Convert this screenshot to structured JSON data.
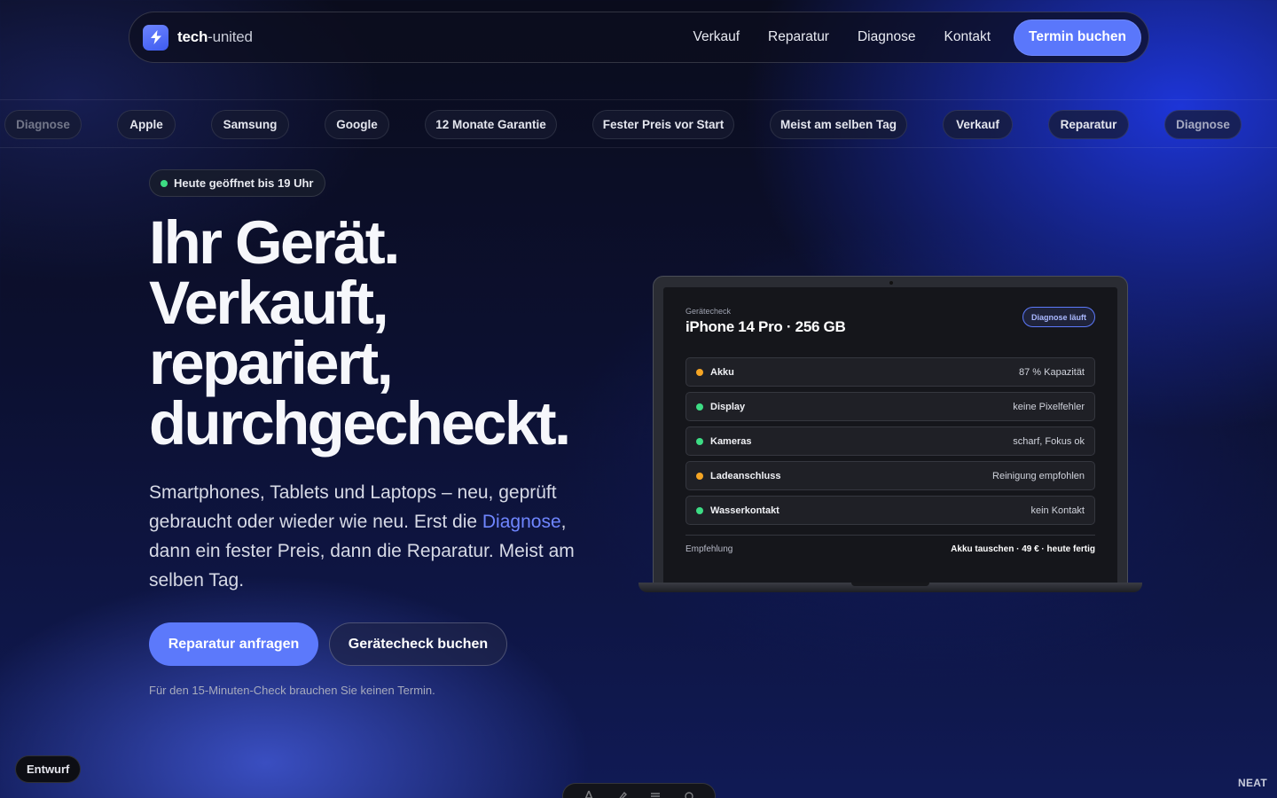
{
  "nav": {
    "brand_bold": "tech",
    "brand_rest": "-united",
    "links": [
      "Verkauf",
      "Reparatur",
      "Diagnose",
      "Kontakt"
    ],
    "cta": "Termin buchen",
    "logo_icon": "lightning-bolt-icon"
  },
  "ticker": {
    "chips": [
      "Diagnose",
      "Apple",
      "Samsung",
      "Google",
      "12 Monate Garantie",
      "Fester Preis vor Start",
      "Meist am selben Tag",
      "Verkauf",
      "Reparatur",
      "Diagnose"
    ]
  },
  "hero": {
    "status": "Heute geöffnet bis 19 Uhr",
    "headline": [
      "Ihr Gerät.",
      "Verkauft,",
      "repariert,",
      "durchgecheckt."
    ],
    "sub_before": "Smartphones, Tablets und Laptops – neu, geprüft gebraucht oder wieder wie neu. Erst die ",
    "sub_accent": "Diagnose",
    "sub_after": ", dann ein fester Preis, dann die Reparatur. Meist am selben Tag.",
    "primary_cta": "Reparatur anfragen",
    "secondary_cta": "Gerätecheck buchen",
    "note": "Für den 15-Minuten-Check brauchen Sie keinen Termin."
  },
  "device_check": {
    "label": "Gerätecheck",
    "title": "iPhone 14 Pro · 256 GB",
    "badge": "Diagnose läuft",
    "rows": [
      {
        "name": "Akku",
        "value": "87 % Kapazität",
        "status": "orange"
      },
      {
        "name": "Display",
        "value": "keine Pixelfehler",
        "status": "green"
      },
      {
        "name": "Kameras",
        "value": "scharf, Fokus ok",
        "status": "green"
      },
      {
        "name": "Ladeanschluss",
        "value": "Reinigung empfohlen",
        "status": "orange"
      },
      {
        "name": "Wasserkontakt",
        "value": "kein Kontakt",
        "status": "green"
      }
    ],
    "recommendation_label": "Empfehlung",
    "recommendation_value": "Akku tauschen · 49 € · heute fertig"
  },
  "footer": {
    "draft": "Entwurf",
    "neat": "NEAT"
  },
  "colors": {
    "accent": "#5c79fb",
    "status_green": "#3ddc84",
    "status_orange": "#f5a524"
  }
}
